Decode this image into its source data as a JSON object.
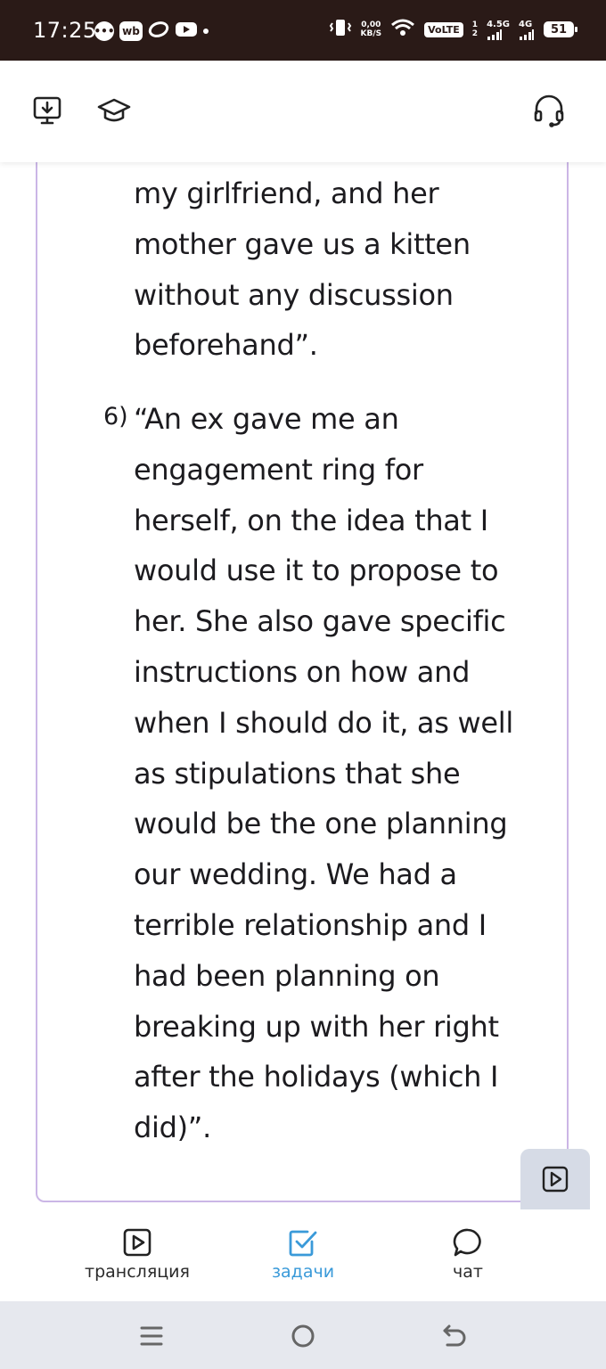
{
  "status_bar": {
    "time": "17:25",
    "wb_label": "wb",
    "speed_value": "0,00",
    "speed_unit": "KB/S",
    "volte_label": "VoLTE",
    "sim1": "1",
    "sim2": "2",
    "net1": "4.5G",
    "net2": "4G",
    "battery": "51"
  },
  "toolbar": {
    "left_icons": [
      "download-icon",
      "graduation-cap-icon"
    ],
    "right_icon": "headset-icon"
  },
  "content": {
    "para1": "my girlfriend, and her mother gave us a kitten without any discussion beforehand”.",
    "item_number": "6)",
    "para2": "“An ex gave me an engagement ring for herself, on the idea that I would use it to propose to her. She also gave specific instructions on how and when I should do it, as well as stipulations that she would be the one planning our wedding. We had a terrible relationship and I had been planning on breaking up with her right after the holidays (which I did)”."
  },
  "bottom_nav": {
    "items": [
      {
        "label": "трансляция",
        "icon": "play-icon",
        "active": false
      },
      {
        "label": "задачи",
        "icon": "checkbox-icon",
        "active": true
      },
      {
        "label": "чат",
        "icon": "chat-bubble-icon",
        "active": false
      }
    ]
  },
  "colors": {
    "status_bar_bg": "#2a1a17",
    "card_border": "#cbb6e6",
    "accent": "#3a9ad9",
    "system_bar_bg": "#e6e8ee"
  }
}
